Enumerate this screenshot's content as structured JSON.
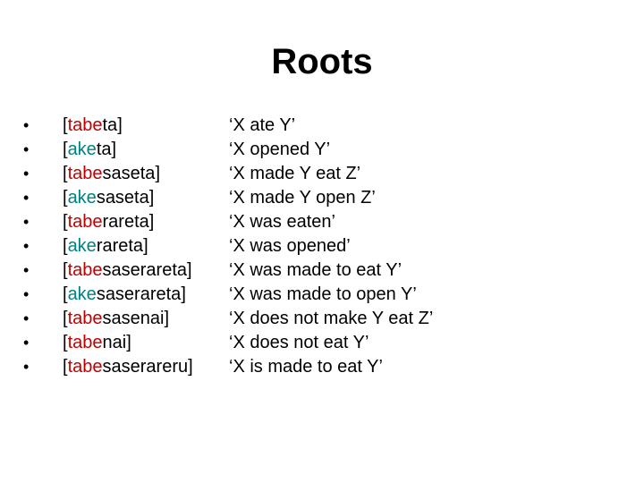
{
  "slide": {
    "title": "Roots",
    "colors": {
      "tabe": "#c00000",
      "ake": "#008080",
      "text": "#000000"
    },
    "items": [
      {
        "root": "tabe",
        "suffix": "ta",
        "gloss": "‘X ate Y’"
      },
      {
        "root": "ake",
        "suffix": "ta",
        "gloss": "‘X opened Y’"
      },
      {
        "root": "tabe",
        "suffix": "saseta",
        "gloss": "‘X made Y eat Z’"
      },
      {
        "root": "ake",
        "suffix": "saseta",
        "gloss": "‘X made Y open Z’"
      },
      {
        "root": "tabe",
        "suffix": "rareta",
        "gloss": "‘X was eaten’"
      },
      {
        "root": "ake",
        "suffix": "rareta",
        "gloss": "‘X was opened’"
      },
      {
        "root": "tabe",
        "suffix": "saserareta",
        "gloss": "‘X was made to eat Y’"
      },
      {
        "root": "ake",
        "suffix": "saserareta",
        "gloss": "‘X was made to open Y’"
      },
      {
        "root": "tabe",
        "suffix": "sasenai",
        "gloss": "‘X does not make Y eat Z’"
      },
      {
        "root": "tabe",
        "suffix": "nai",
        "gloss": "‘X does not eat Y’"
      },
      {
        "root": "tabe",
        "suffix": "saserareru",
        "gloss": "‘X is made to eat Y’"
      }
    ],
    "bullet_glyph": "•",
    "open_bracket": "[",
    "close_bracket": "]"
  }
}
